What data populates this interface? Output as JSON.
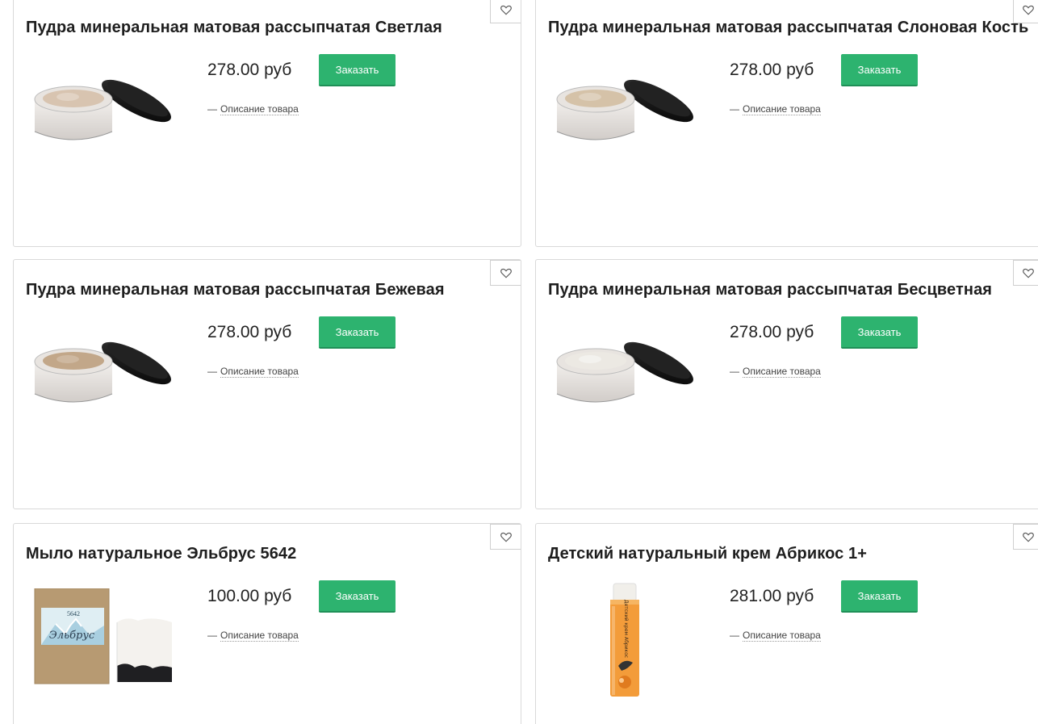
{
  "products": [
    {
      "title": "Пудра минеральная матовая рассыпчатая Светлая",
      "price": "278.00 руб",
      "order_label": "Заказать",
      "desc_dash": "—",
      "desc_link": "Описание товара",
      "image": "powder-jar",
      "powder_color": "#d8c4b0"
    },
    {
      "title": "Пудра минеральная матовая рассыпчатая Слоновая Кость",
      "price": "278.00 руб",
      "order_label": "Заказать",
      "desc_dash": "—",
      "desc_link": "Описание товара",
      "image": "powder-jar",
      "powder_color": "#d5c2a8"
    },
    {
      "title": "Пудра минеральная матовая рассыпчатая Бежевая",
      "price": "278.00 руб",
      "order_label": "Заказать",
      "desc_dash": "—",
      "desc_link": "Описание товара",
      "image": "powder-jar",
      "powder_color": "#c2a789"
    },
    {
      "title": "Пудра минеральная матовая рассыпчатая Бесцветная",
      "price": "278.00 руб",
      "order_label": "Заказать",
      "desc_dash": "—",
      "desc_link": "Описание товара",
      "image": "powder-jar",
      "powder_color": "#ece9e3"
    },
    {
      "title": "Мыло натуральное Эльбрус 5642",
      "price": "100.00 руб",
      "order_label": "Заказать",
      "desc_dash": "—",
      "desc_link": "Описание товара",
      "image": "soap-package",
      "package_text": "Эльбрус",
      "package_number": "5642"
    },
    {
      "title": "Детский натуральный крем Абрикос 1+",
      "price": "281.00 руб",
      "order_label": "Заказать",
      "desc_dash": "—",
      "desc_link": "Описание товара",
      "image": "cream-tube",
      "tube_text": "Детский крем Абрикос"
    }
  ],
  "colors": {
    "accent": "#2db36f",
    "border": "#d9d9d9",
    "text": "#1e1e1e"
  },
  "icons": {
    "favorite": "heart-outline-icon"
  }
}
